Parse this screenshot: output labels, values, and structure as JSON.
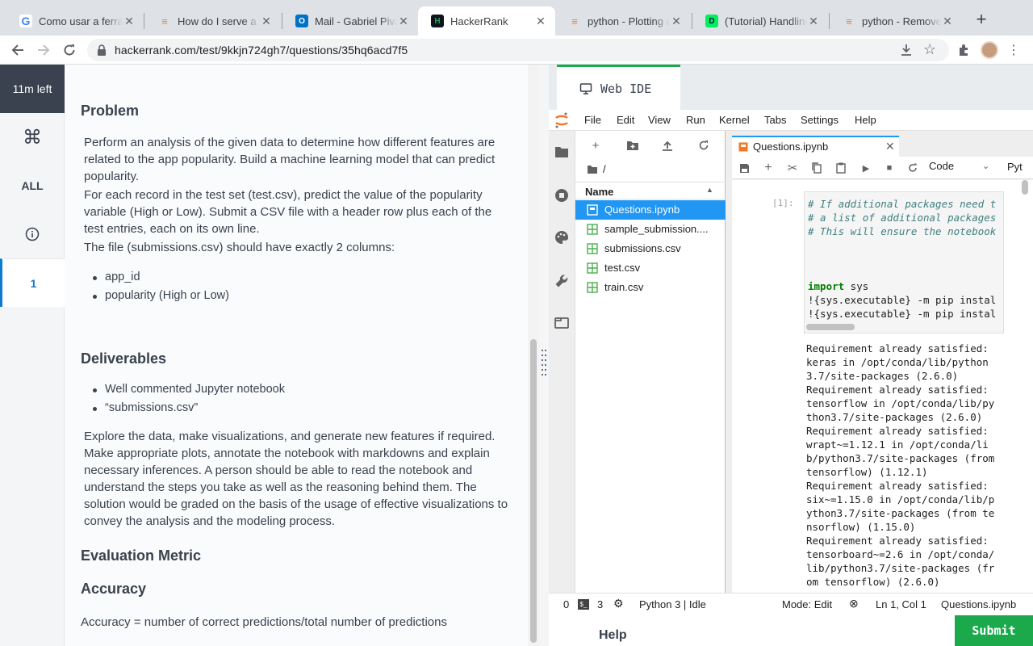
{
  "browser": {
    "tabs": [
      {
        "title": "Como usar a ferramenta",
        "favicon": "G"
      },
      {
        "title": "How do I serve a template",
        "favicon": "SO"
      },
      {
        "title": "Mail - Gabriel Pivato",
        "favicon": "O"
      },
      {
        "title": "HackerRank",
        "favicon": "H",
        "active": true
      },
      {
        "title": "python - Plotting categorical",
        "favicon": "SO"
      },
      {
        "title": "(Tutorial) Handling Missing",
        "favicon": "D"
      },
      {
        "title": "python - Remove",
        "favicon": "SO"
      }
    ],
    "new_tab": "+",
    "url": "hackerrank.com/test/9kkjn724gh7/questions/35hq6acd7f5"
  },
  "sidebar": {
    "time_left": "11m left",
    "all": "ALL",
    "question_number": "1"
  },
  "problem": {
    "heading": "Problem",
    "p1": "Perform an analysis of the given data to determine how different features are related to the app popularity.  Build a machine learning model that can predict popularity.",
    "p2": "For each record in the test set (test.csv), predict the value of the popularity variable (High or Low). Submit a CSV file with a header row plus each of the test entries, each on its own line.",
    "p3": "The file (submissions.csv) should have exactly 2 columns:",
    "columns": [
      "app_id",
      "popularity (High or Low)"
    ],
    "deliverables_heading": "Deliverables",
    "deliverables": [
      "Well commented Jupyter notebook",
      "“submissions.csv”"
    ],
    "p4": "Explore the data, make visualizations, and generate new features if required. Make appropriate plots, annotate the notebook with markdowns and explain necessary inferences. A person should be able to read the notebook and understand the steps you take as well as the reasoning behind them. The solution would be graded on the basis of the usage of effective visualizations to convey the analysis and the modeling process.",
    "metric_heading": "Evaluation Metric",
    "accuracy_heading": "Accuracy",
    "formula": "Accuracy = number of correct predictions/total number of predictions"
  },
  "ide": {
    "tab_label": "Web IDE",
    "menu": [
      "File",
      "Edit",
      "View",
      "Run",
      "Kernel",
      "Tabs",
      "Settings",
      "Help"
    ],
    "root_path": "/",
    "name_header": "Name",
    "files": [
      "Questions.ipynb",
      "sample_submission....",
      "submissions.csv",
      "test.csv",
      "train.csv"
    ],
    "notebook_tab": "Questions.ipynb",
    "cell_type": "Code",
    "kernel_short": "Pyt",
    "cell_prompt": "[1]:",
    "code_comments": [
      "# If additional packages need t",
      "# a list of additional packages",
      "# This will ensure the notebook"
    ],
    "code_import_kw": "import",
    "code_import_rest": " sys",
    "code_pip1": "!{sys.executable} -m pip instal",
    "code_pip2": "!{sys.executable} -m pip instal",
    "output": "Requirement already satisfied:\nkeras in /opt/conda/lib/python\n3.7/site-packages (2.6.0)\nRequirement already satisfied:\ntensorflow in /opt/conda/lib/py\nthon3.7/site-packages (2.6.0)\nRequirement already satisfied:\nwrapt~=1.12.1 in /opt/conda/li\nb/python3.7/site-packages (from\ntensorflow) (1.12.1)\nRequirement already satisfied:\nsix~=1.15.0 in /opt/conda/lib/p\nython3.7/site-packages (from te\nnsorflow) (1.15.0)\nRequirement already satisfied:\ntensorboard~=2.6 in /opt/conda/\nlib/python3.7/site-packages (fr\nom tensorflow) (2.6.0)",
    "status": {
      "zero": "0",
      "terminals": "3",
      "kernel": "Python 3 | Idle",
      "mode": "Mode: Edit",
      "cursor": "Ln 1, Col 1",
      "file": "Questions.ipynb"
    },
    "help": "Help",
    "submit": "Submit"
  },
  "colors": {
    "accent": "#1ba94c",
    "jupyter_blue": "#2196f3",
    "sidebar_dark": "#39424e"
  }
}
